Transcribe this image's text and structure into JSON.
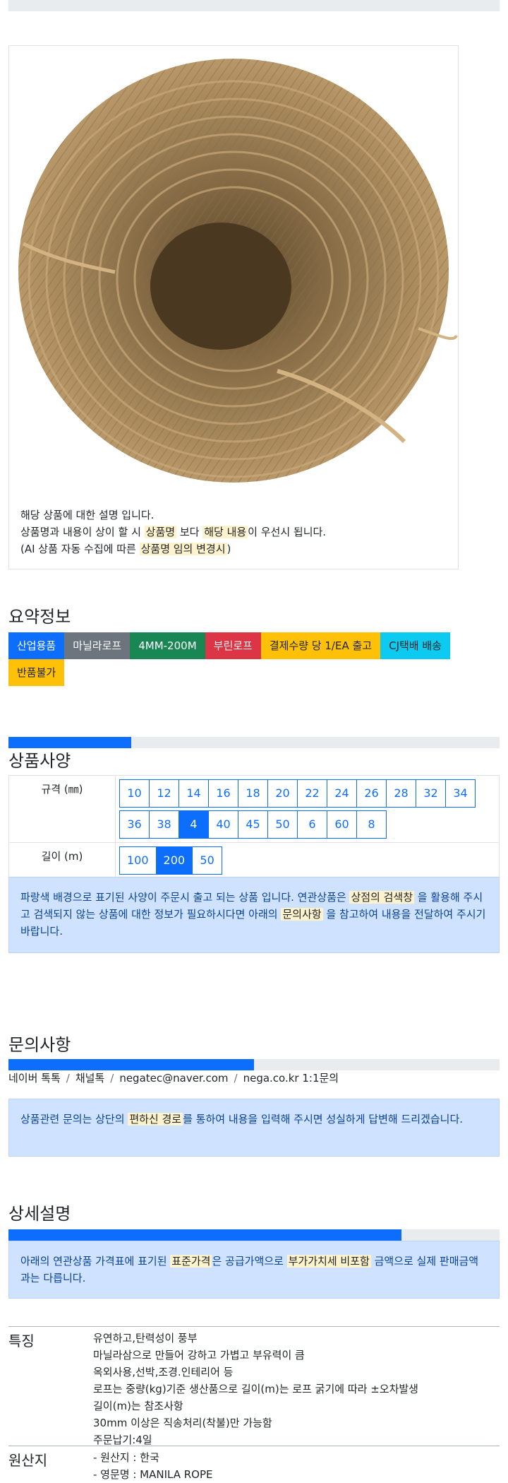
{
  "product_desc": {
    "line1": "해당 상품에 대한 설명 입니다.",
    "line2_a": "상품명과 내용이 상이 할 시 ",
    "line2_mark1": "상품명",
    "line2_b": " 보다 ",
    "line2_mark2": "해당 내용",
    "line2_c": "이 우선시 됩니다.",
    "line3_a": "(AI 상품 자동 수집에 따른 ",
    "line3_mark": "상품명 임의 변경시",
    "line3_b": ")"
  },
  "summary": {
    "title": "요약정보",
    "badges": [
      {
        "label": "산업용품",
        "color": "#0d6efd",
        "text": "#ffffff"
      },
      {
        "label": "마닐라로프",
        "color": "#6c757d",
        "text": "#ffffff"
      },
      {
        "label": "4MM-200M",
        "color": "#198754",
        "text": "#ffffff"
      },
      {
        "label": "부린로프",
        "color": "#dc3545",
        "text": "#ffffff"
      },
      {
        "label": "결제수량 당 1/EA 출고",
        "color": "#ffc107",
        "text": "#212529"
      },
      {
        "label": "CJ택배 배송",
        "color": "#0dcaf0",
        "text": "#212529"
      },
      {
        "label": "반품불가",
        "color": "#ffc107",
        "text": "#212529"
      }
    ]
  },
  "spec": {
    "title": "상품사양",
    "size_label": "규격 (㎜)",
    "sizes": [
      "10",
      "12",
      "14",
      "16",
      "18",
      "20",
      "22",
      "24",
      "26",
      "28",
      "32",
      "34",
      "36",
      "38",
      "4",
      "40",
      "45",
      "50",
      "6",
      "60",
      "8"
    ],
    "size_selected": "4",
    "length_label": "길이 (m)",
    "lengths": [
      "100",
      "200",
      "50"
    ],
    "length_selected": "200",
    "notice_a": "파랑색 배경으로 표기된 사양이 주문시 출고 되는 상품 입니다. 연관상품은 ",
    "notice_mark1": "상점의 검색창",
    "notice_b": " 을 활용해 주시고 검색되지 않는 상품에 대한 정보가 필요하시다면 아래의 ",
    "notice_mark2": "문의사항",
    "notice_c": " 을 참고하여 내용을 전달하여 주시기 바랍니다."
  },
  "inquiry": {
    "title": "문의사항",
    "progress": 0.5,
    "contacts": [
      "네이버 톡톡",
      "채널톡",
      "negatec@naver.com",
      "nega.co.kr 1:1문의"
    ],
    "notice_a": "상품관련 문의는 상단의 ",
    "notice_mark": "편하신 경로",
    "notice_b": "를 통하여 내용을 입력해 주시면 성실하게 답변해 드리겠습니다."
  },
  "detail": {
    "title": "상세설명",
    "progress": 0.8,
    "notice_a": "아래의 연관상품 가격표에 표기된 ",
    "notice_mark1": "표준가격",
    "notice_b": "은 공급가액으로 ",
    "notice_mark2": "부가가치세 비포함",
    "notice_c": " 금액으로 실제 판매금액과는 다릅니다."
  },
  "spec_progress": 0.25,
  "features": {
    "label": "특징",
    "lines": [
      "유연하고,탄력성이 풍부",
      "마닐라삼으로 만들어 강하고 가볍고 부유력이 큼",
      "옥외사용,선박,조경.인테리어 등",
      "로프는 중량(kg)기준 생산품으로 길이(m)는 로프 굵기에 따라 ±오차발생",
      "길이(m)는 참조사항",
      "30mm 이상은 직송처리(착불)만 가능함",
      "주문납기:4일"
    ]
  },
  "origin": {
    "label": "원산지",
    "lines": [
      "- 원산지 : 한국",
      "- 영문명 : MANILA ROPE"
    ]
  }
}
